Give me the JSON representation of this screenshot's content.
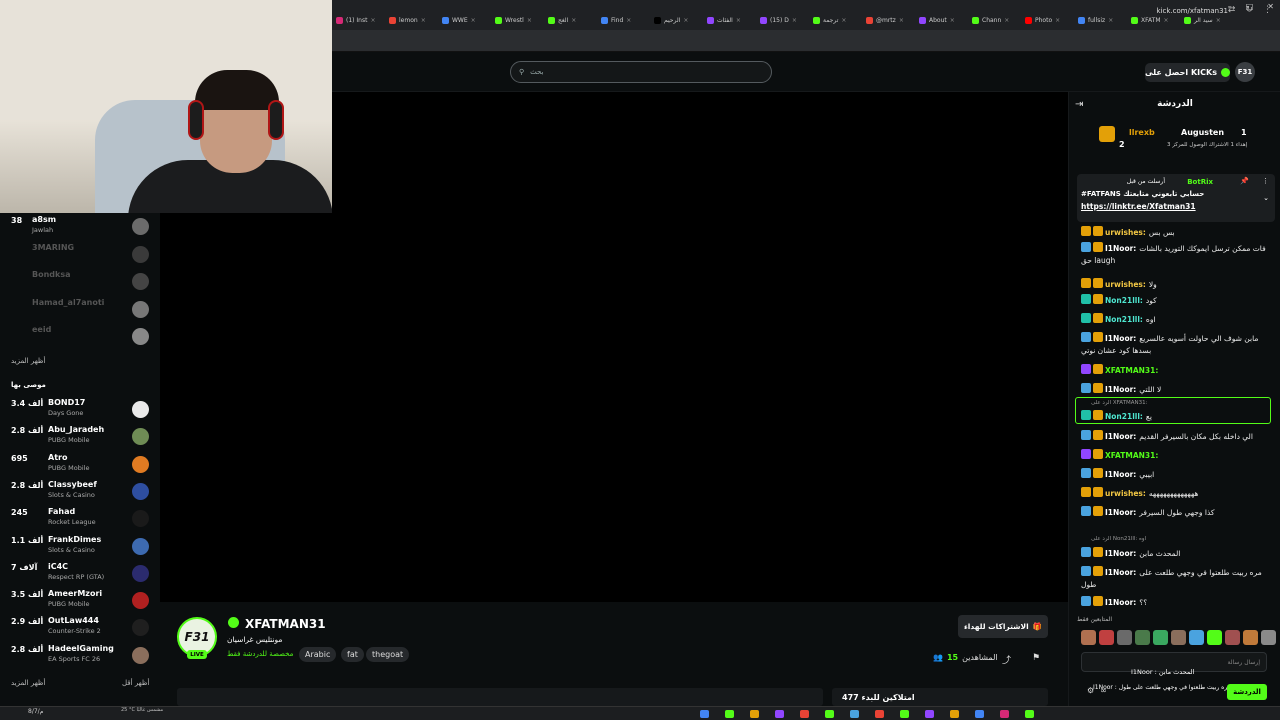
{
  "browser": {
    "tabs": [
      {
        "label": "(1) Inst",
        "color": "#d62976"
      },
      {
        "label": "lemon",
        "color": "#ea4335"
      },
      {
        "label": "WWE",
        "color": "#4285f4"
      },
      {
        "label": "Wrestl",
        "color": "#53fc18"
      },
      {
        "label": "الغج",
        "color": "#53fc18"
      },
      {
        "label": "Find",
        "color": "#4285f4"
      },
      {
        "label": "الرحيم",
        "color": "#000000"
      },
      {
        "label": "الفئات",
        "color": "#9146ff"
      },
      {
        "label": "(15) D",
        "color": "#9146ff"
      },
      {
        "label": "ترجمة",
        "color": "#53fc18"
      },
      {
        "label": "@mrtz",
        "color": "#ea4335"
      },
      {
        "label": "About",
        "color": "#9146ff"
      },
      {
        "label": "Chann",
        "color": "#53fc18"
      },
      {
        "label": "Photo",
        "color": "#ff0000"
      },
      {
        "label": "fullsiz",
        "color": "#4285f4"
      },
      {
        "label": "XFATM",
        "color": "#53fc18"
      },
      {
        "label": "سيد الر",
        "color": "#53fc18"
      }
    ],
    "url": "kick.com/xfatman31",
    "window_controls": [
      "–",
      "□",
      "✕"
    ]
  },
  "topbar": {
    "search_placeholder": "بحث",
    "get_kicks": "احصل على KICKs",
    "avatar": "F31"
  },
  "sidebar": {
    "following": [
      {
        "name": "a8sm",
        "count": "38",
        "sub": "Jawlah",
        "online": true,
        "avatar_color": "#6b6b6b"
      },
      {
        "name": "3MARING",
        "online": false,
        "avatar_color": "#3a3a3a"
      },
      {
        "name": "Bondksa",
        "online": false,
        "avatar_color": "#444"
      },
      {
        "name": "Hamad_al7anoti",
        "online": false,
        "avatar_color": "#777"
      },
      {
        "name": "eeid",
        "online": false,
        "avatar_color": "#888"
      }
    ],
    "show_more_1": "أظهر المزيد",
    "recommended_title": "موصى بها",
    "recommended": [
      {
        "name": "BOND17",
        "count": "3.4 ألف",
        "sub": "Days Gone",
        "avatar_color": "#e9e9e9"
      },
      {
        "name": "Abu_Jaradeh",
        "count": "2.8 ألف",
        "sub": "PUBG Mobile",
        "avatar_color": "#6f8c55"
      },
      {
        "name": "Atro",
        "count": "695",
        "sub": "PUBG Mobile",
        "avatar_color": "#e07b22"
      },
      {
        "name": "Classybeef",
        "count": "2.8 ألف",
        "sub": "Slots & Casino",
        "avatar_color": "#2e4ea0"
      },
      {
        "name": "Fahad",
        "count": "245",
        "sub": "Rocket League",
        "avatar_color": "#1a1a1a"
      },
      {
        "name": "FrankDimes",
        "count": "1.1 ألف",
        "sub": "Slots & Casino",
        "avatar_color": "#3d6ab0"
      },
      {
        "name": "iC4C",
        "count": "7 آلاف",
        "sub": "Respect RP (GTA)",
        "avatar_color": "#2b2b6e"
      },
      {
        "name": "AmeerMzori",
        "count": "3.5 ألف",
        "sub": "PUBG Mobile",
        "avatar_color": "#b02020"
      },
      {
        "name": "OutLaw444",
        "count": "2.9 ألف",
        "sub": "Counter-Strike 2",
        "avatar_color": "#1f1f1f"
      },
      {
        "name": "HadeelGaming",
        "count": "2.8 ألف",
        "sub": "EA Sports FC 26",
        "avatar_color": "#8a6e5c"
      }
    ],
    "show_more_2": "أظهر المزيد",
    "show_less": "أظهر أقل"
  },
  "channel": {
    "logo": "F31",
    "live": "LIVE",
    "name": "XFATMAN31",
    "title": "مونتليس غراسيان",
    "category": "مخصصة للدردشة فقط",
    "tags": [
      "Arabic",
      "fat",
      "thegoat"
    ],
    "gift_label": "الاشتراكات للهداء",
    "viewers_label": "المشاهدين",
    "viewers_count": "15",
    "clip_label": "امتلاكين للبدء 477"
  },
  "chat": {
    "title": "الدردشة",
    "leaders": [
      {
        "rank": "1",
        "name": "Augusten"
      },
      {
        "rank": "2",
        "name": "llrexb"
      }
    ],
    "leader_subtitle": "إهداء 1 الاشتراك الوصول للمركز 3",
    "pinned": {
      "by": "أرسلت من قبل",
      "author": "BotRix",
      "message": "#FATFANS حسابي تابعوني متابعتك",
      "link": "https://linktr.ee/Xfatman31"
    },
    "messages": [
      {
        "user": "urwishes:",
        "text": "بس بس",
        "color": "#f2c744"
      },
      {
        "user": "I1Noor:",
        "text": "فات ممكن ترسل ايموكك التوريد بالشات حق laugh",
        "color": "#ffffff"
      },
      {
        "user": "urwishes:",
        "text": "ولا",
        "color": "#f2c744"
      },
      {
        "user": "Non21lll:",
        "text": "كود",
        "color": "#4ee6d0"
      },
      {
        "user": "Non21lll:",
        "text": "اوه",
        "color": "#4ee6d0"
      },
      {
        "user": "I1Noor:",
        "text": "مابن شوف الي حاولت أسويه عالسريع بسدها كود عشان نوتي",
        "color": "#ffffff"
      },
      {
        "user": "XFATMAN31:",
        "text": "",
        "color": "#53fc18"
      },
      {
        "user": "I1Noor:",
        "text": "لا اللتي",
        "color": "#ffffff"
      },
      {
        "user": "Non21lll:",
        "text": "يع",
        "color": "#4ee6d0"
      },
      {
        "user": "I1Noor:",
        "text": "الي داخله بكل مكان بالسيرفر القديم",
        "color": "#ffffff"
      },
      {
        "user": "XFATMAN31:",
        "text": "",
        "color": "#53fc18"
      },
      {
        "user": "I1Noor:",
        "text": "ابيبي",
        "color": "#ffffff"
      },
      {
        "user": "urwishes:",
        "text": "هههههههههههههه",
        "color": "#f2c744"
      },
      {
        "user": "I1Noor:",
        "text": "كذا وجهي طول السيرفر",
        "color": "#ffffff"
      },
      {
        "user": "I1Noor:",
        "text": "المحدث مابن",
        "color": "#ffffff"
      },
      {
        "user": "I1Noor:",
        "text": "مره ربيت طلعتوا في وجهي طلعت على طول",
        "color": "#ffffff"
      },
      {
        "user": "I1Noor:",
        "text": "؟؟",
        "color": "#ffffff"
      }
    ],
    "reply_1": "الرد على XFATMAN31:",
    "reply_2": "الرد على Non21lll: اوه",
    "followers_only": "المتابعين فقط",
    "input_placeholder": "إرسال رسالة",
    "send": "الدردشة",
    "preview_1": "I1Noor : المحدث مابن",
    "preview_2": "I1Noor : مره ربيت طلعتوا في وجهي طلعت على طول"
  },
  "taskbar": {
    "time": "8/7/م",
    "weather": "25 °C مشمس غالبًا"
  }
}
